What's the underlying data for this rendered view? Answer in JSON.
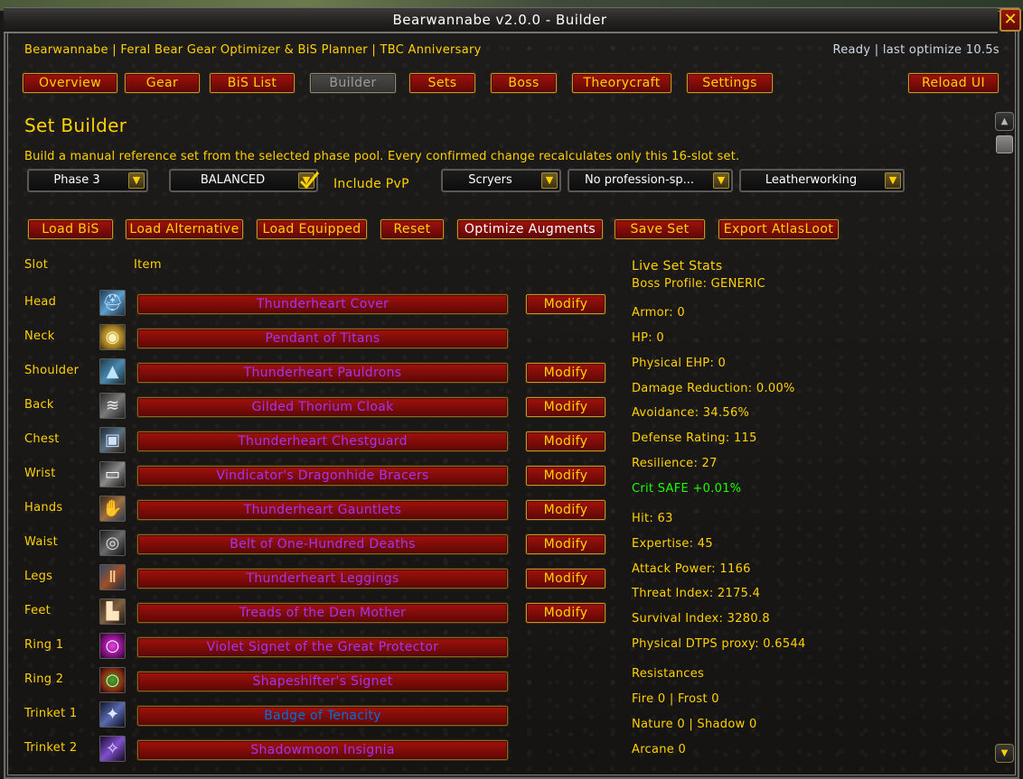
{
  "window": {
    "title": "Bearwannabe v2.0.0  -  Builder",
    "close_glyph": "✕"
  },
  "header": {
    "subtitle": "Bearwannabe | Feral Bear Gear Optimizer & BiS Planner | TBC Anniversary",
    "status": "Ready | last optimize 10.5s"
  },
  "tabs": [
    {
      "label": "Overview",
      "state": "normal"
    },
    {
      "label": "Gear",
      "state": "normal"
    },
    {
      "label": "BiS List",
      "state": "normal"
    },
    {
      "label": "Builder",
      "state": "disabled"
    },
    {
      "label": "Sets",
      "state": "normal"
    },
    {
      "label": "Boss",
      "state": "normal"
    },
    {
      "label": "Theorycraft",
      "state": "normal"
    },
    {
      "label": "Settings",
      "state": "normal"
    }
  ],
  "reload_label": "Reload UI",
  "builder": {
    "title": "Set Builder",
    "description": "Build a manual reference set from the selected phase pool. Every confirmed change recalculates only this 16-slot set.",
    "dropdowns": {
      "phase": "Phase 3",
      "mode": "BALANCED",
      "faction": "Scryers",
      "profession_special": "No profession-sp...",
      "profession": "Leatherworking"
    },
    "include_pvp_label": "Include PvP",
    "include_pvp_checked": true,
    "actions": {
      "load_bis": "Load BiS",
      "load_alternative": "Load Alternative",
      "load_equipped": "Load Equipped",
      "reset": "Reset",
      "optimize_augments": "Optimize Augments",
      "save_set": "Save Set",
      "export_atlasloot": "Export AtlasLoot"
    },
    "columns": {
      "slot": "Slot",
      "item": "Item"
    },
    "modify_label": "Modify",
    "slots": [
      {
        "slot": "Head",
        "item": "Thunderheart Cover",
        "quality_color": "#a335ee",
        "icon": "helm-icon",
        "modify": true
      },
      {
        "slot": "Neck",
        "item": "Pendant of Titans",
        "quality_color": "#a335ee",
        "icon": "amulet-icon",
        "modify": false
      },
      {
        "slot": "Shoulder",
        "item": "Thunderheart Pauldrons",
        "quality_color": "#a335ee",
        "icon": "shoulder-icon",
        "modify": true
      },
      {
        "slot": "Back",
        "item": "Gilded Thorium Cloak",
        "quality_color": "#a335ee",
        "icon": "cloak-icon",
        "modify": true
      },
      {
        "slot": "Chest",
        "item": "Thunderheart Chestguard",
        "quality_color": "#a335ee",
        "icon": "chest-icon",
        "modify": true
      },
      {
        "slot": "Wrist",
        "item": "Vindicator's Dragonhide Bracers",
        "quality_color": "#a335ee",
        "icon": "bracer-icon",
        "modify": true
      },
      {
        "slot": "Hands",
        "item": "Thunderheart Gauntlets",
        "quality_color": "#a335ee",
        "icon": "gauntlet-icon",
        "modify": true
      },
      {
        "slot": "Waist",
        "item": "Belt of One-Hundred Deaths",
        "quality_color": "#a335ee",
        "icon": "belt-icon",
        "modify": true
      },
      {
        "slot": "Legs",
        "item": "Thunderheart Leggings",
        "quality_color": "#a335ee",
        "icon": "legs-icon",
        "modify": true
      },
      {
        "slot": "Feet",
        "item": "Treads of the Den Mother",
        "quality_color": "#a335ee",
        "icon": "boots-icon",
        "modify": true
      },
      {
        "slot": "Ring 1",
        "item": "Violet Signet of the Great Protector",
        "quality_color": "#a335ee",
        "icon": "ring-icon",
        "modify": false
      },
      {
        "slot": "Ring 2",
        "item": "Shapeshifter's Signet",
        "quality_color": "#a335ee",
        "icon": "ring-icon",
        "modify": false
      },
      {
        "slot": "Trinket 1",
        "item": "Badge of Tenacity",
        "quality_color": "#0070dd",
        "icon": "badge-icon",
        "modify": false
      },
      {
        "slot": "Trinket 2",
        "item": "Shadowmoon Insignia",
        "quality_color": "#a335ee",
        "icon": "insignia-icon",
        "modify": false
      }
    ]
  },
  "stats": {
    "title": "Live Set Stats",
    "boss_profile": "Boss Profile: GENERIC",
    "armor": "Armor: 0",
    "hp": "HP: 0",
    "physical_ehp": "Physical EHP: 0",
    "damage_reduction": "Damage Reduction: 0.00%",
    "avoidance": "Avoidance: 34.56%",
    "defense_rating": "Defense Rating: 115",
    "resilience": "Resilience: 27",
    "crit": "Crit SAFE +0.01%",
    "hit": "Hit: 63",
    "expertise": "Expertise: 45",
    "attack_power": "Attack Power: 1166",
    "threat_index": "Threat Index: 2175.4",
    "survival_index": "Survival Index: 3280.8",
    "physical_dtps": "Physical DTPS proxy: 0.6544",
    "resistances_title": "Resistances",
    "fire_frost": "Fire 0 | Frost 0",
    "nature_shadow": "Nature 0 | Shadow 0",
    "arcane": "Arcane 0"
  }
}
